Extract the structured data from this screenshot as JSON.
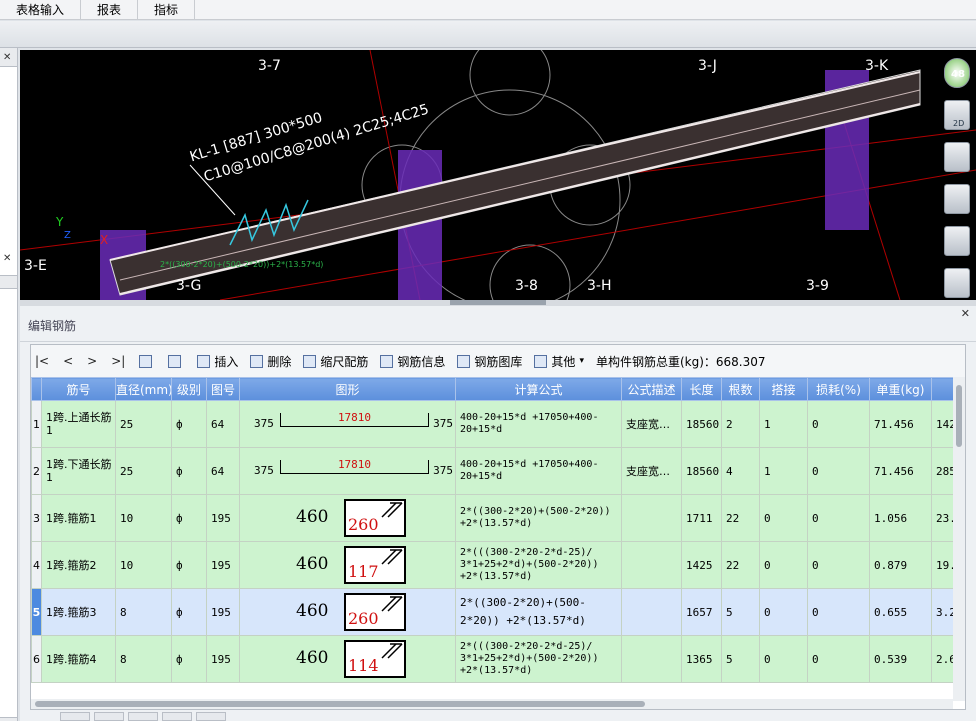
{
  "menu": {
    "items": [
      "表格输入",
      "报表",
      "指标"
    ]
  },
  "viewport": {
    "axes": [
      "3-7",
      "3-J",
      "3-K",
      "3-E",
      "3-G",
      "3-8",
      "3-H",
      "3-9"
    ],
    "beam_label_1": "KL-1 [887] 300*500",
    "beam_label_2": "C10@100/C8@200(4) 2C25;4C25",
    "small_label": "2*((300-2*20)+(500-2*20))+2*(13.57*d)",
    "axis_x": "X",
    "axis_y": "Y",
    "axis_z": "Z",
    "view_badge": "48",
    "view_mode": "2D"
  },
  "panel": {
    "title": "编辑钢筋",
    "toolbar": {
      "nav_first": "|<",
      "nav_prev": "<",
      "nav_next": ">",
      "nav_last": ">|",
      "insert": "插入",
      "delete": "删除",
      "scale": "缩尺配筋",
      "rebar_info": "钢筋信息",
      "rebar_library": "钢筋图库",
      "other": "其他",
      "total_weight": "单构件钢筋总重(kg)：668.307"
    },
    "columns": [
      "筋号",
      "直径(mm)",
      "级别",
      "图号",
      "图形",
      "计算公式",
      "公式描述",
      "长度",
      "根数",
      "搭接",
      "损耗(%)",
      "单重(kg)",
      "总"
    ],
    "rows": [
      {
        "num": "1",
        "name": "1跨.上通长筋1",
        "dia": "25",
        "grade": "ф",
        "fig": "64",
        "shape": {
          "kind": "bar",
          "left": "375",
          "mid": "17810",
          "right": "375"
        },
        "formula": "400-20+15*d +17050+400-20+15*d",
        "desc": "支座宽…",
        "len": "18560",
        "count": "2",
        "lap": "1",
        "loss": "0",
        "unit_w": "71.456",
        "total_w": "142."
      },
      {
        "num": "2",
        "name": "1跨.下通长筋1",
        "dia": "25",
        "grade": "ф",
        "fig": "64",
        "shape": {
          "kind": "bar",
          "left": "375",
          "mid": "17810",
          "right": "375"
        },
        "formula": "400-20+15*d +17050+400-20+15*d",
        "desc": "支座宽…",
        "len": "18560",
        "count": "4",
        "lap": "1",
        "loss": "0",
        "unit_w": "71.456",
        "total_w": "285."
      },
      {
        "num": "3",
        "name": "1跨.箍筋1",
        "dia": "10",
        "grade": "ф",
        "fig": "195",
        "shape": {
          "kind": "stir",
          "a": "460",
          "b": "260"
        },
        "formula": "2*((300-2*20)+(500-2*20)) +2*(13.57*d)",
        "desc": "",
        "len": "1711",
        "count": "22",
        "lap": "0",
        "loss": "0",
        "unit_w": "1.056",
        "total_w": "23."
      },
      {
        "num": "4",
        "name": "1跨.箍筋2",
        "dia": "10",
        "grade": "ф",
        "fig": "195",
        "shape": {
          "kind": "stir",
          "a": "460",
          "b": "117"
        },
        "formula": "2*(((300-2*20-2*d-25)/ 3*1+25+2*d)+(500-2*20)) +2*(13.57*d)",
        "desc": "",
        "len": "1425",
        "count": "22",
        "lap": "0",
        "loss": "0",
        "unit_w": "0.879",
        "total_w": "19."
      },
      {
        "num": "5",
        "name": "1跨.箍筋3",
        "dia": "8",
        "grade": "ф",
        "fig": "195",
        "shape": {
          "kind": "stir",
          "a": "460",
          "b": "260"
        },
        "formula": "2*((300-2*20)+(500-2*20)) +2*(13.57*d)",
        "desc": "",
        "len": "1657",
        "count": "5",
        "lap": "0",
        "loss": "0",
        "unit_w": "0.655",
        "total_w": "3.2"
      },
      {
        "num": "6",
        "name": "1跨.箍筋4",
        "dia": "8",
        "grade": "ф",
        "fig": "195",
        "shape": {
          "kind": "stir",
          "a": "460",
          "b": "114"
        },
        "formula": "2*(((300-2*20-2*d-25)/ 3*1+25+2*d)+(500-2*20)) +2*(13.57*d)",
        "desc": "",
        "len": "1365",
        "count": "5",
        "lap": "0",
        "loss": "0",
        "unit_w": "0.539",
        "total_w": "2.6"
      }
    ],
    "selected_row": "5"
  }
}
